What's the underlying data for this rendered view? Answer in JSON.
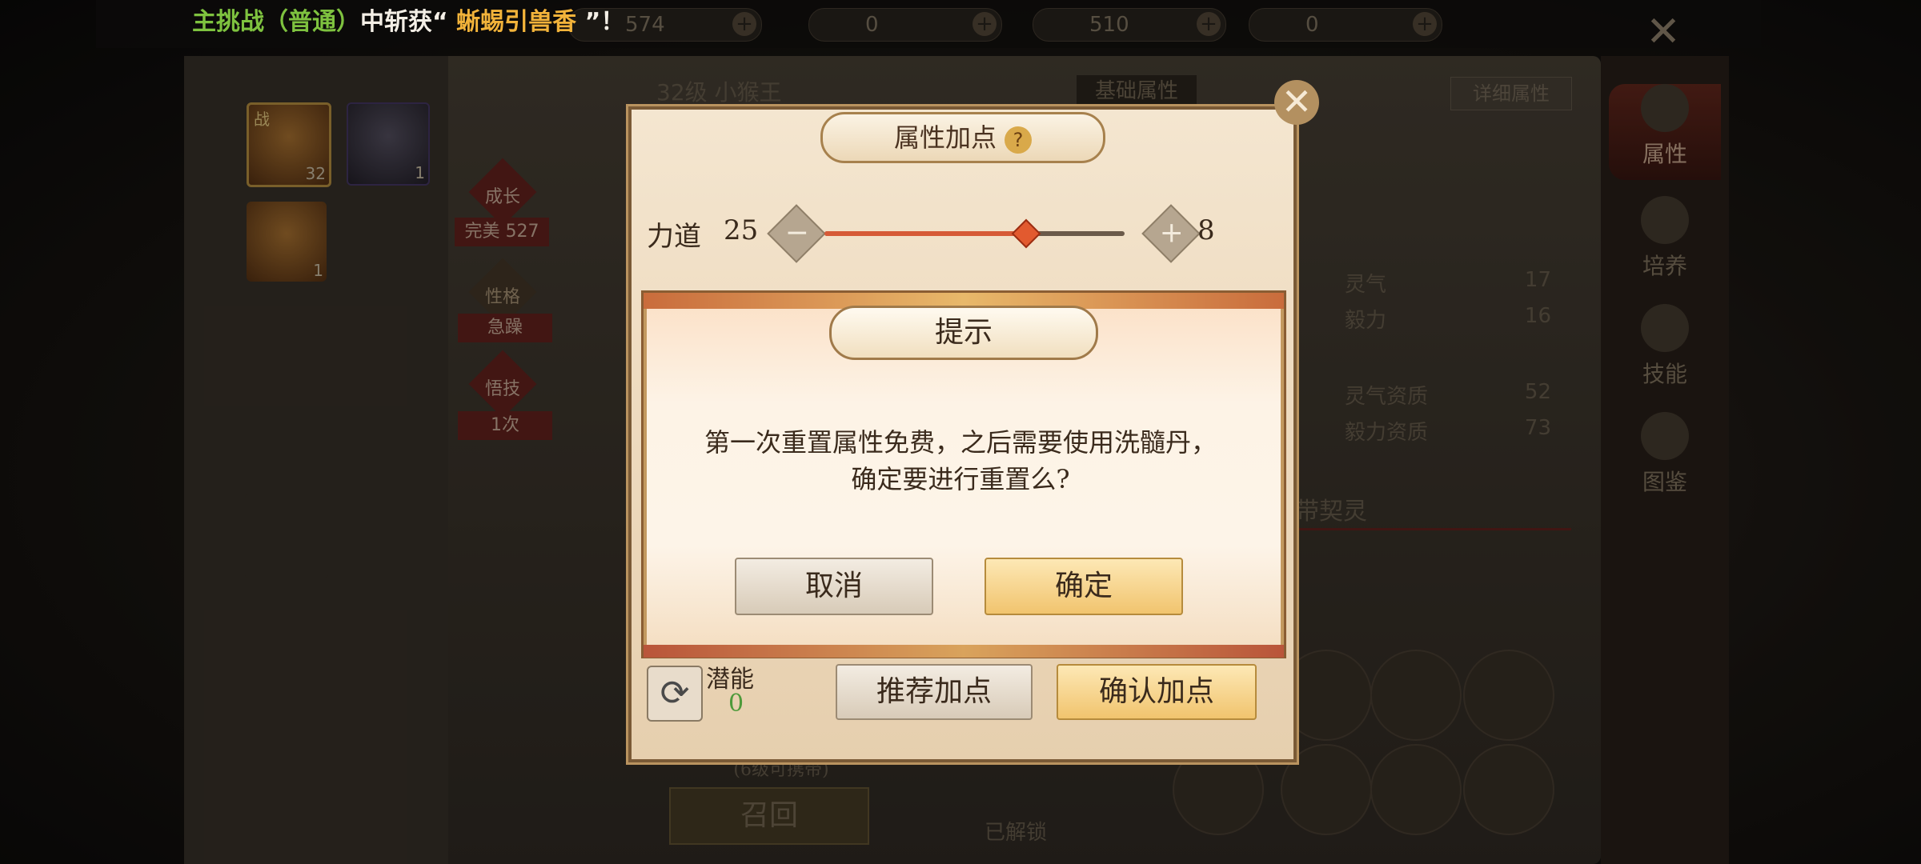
{
  "top_bar": {
    "banner_parts": [
      {
        "text": "主挑战",
        "color": "#7ec23f"
      },
      {
        "text": "（普通）",
        "color": "#7ec23f"
      },
      {
        "text": "中斩获“ ",
        "color": "#f4efe6"
      },
      {
        "text": "蜥蜴引兽香",
        "color": "#f2b33a"
      },
      {
        "text": " ”！",
        "color": "#f4efe6"
      }
    ],
    "resources": [
      {
        "value": "574"
      },
      {
        "value": "0"
      },
      {
        "value": "510"
      },
      {
        "value": "0"
      }
    ]
  },
  "pets": {
    "list": [
      {
        "tag": "战",
        "level": "32"
      },
      {
        "tag": "",
        "level": "1"
      },
      {
        "tag": "",
        "level": "1"
      }
    ],
    "growth_label": "成长",
    "growth_value": "完美 527",
    "personality_label": "性格",
    "personality_value": "急躁",
    "skill_label": "悟技",
    "skill_value": "1次"
  },
  "header": {
    "level_name": "32级 小猴王",
    "basic_attr_tab": "基础属性",
    "detail_attr_button": "详细属性"
  },
  "right_tabs": [
    {
      "label": "属性",
      "icon": "paw-icon",
      "active": true
    },
    {
      "label": "培养",
      "icon": "cultivate-icon",
      "active": false
    },
    {
      "label": "技能",
      "icon": "skill-book-icon",
      "active": false
    },
    {
      "label": "图鉴",
      "icon": "catalog-icon",
      "active": false
    }
  ],
  "right_info": {
    "rows": [
      {
        "name": "灵气",
        "value": "17"
      },
      {
        "name": "毅力",
        "value": "16"
      },
      {
        "name": "灵气资质",
        "value": "52"
      },
      {
        "name": "毅力资质",
        "value": "73"
      }
    ],
    "carry_label": "带契灵"
  },
  "bottom": {
    "recall_button": "召回",
    "carry_level_note": "(6级可携带)",
    "unlocked_label": "已解锁"
  },
  "attr_panel": {
    "title": "属性加点",
    "help": "?",
    "stat_label": "力道",
    "stat_value": "25",
    "stat_points": "8",
    "slider_fraction": 0.67,
    "minus": "−",
    "plus": "+",
    "potential_label": "潜能",
    "potential_value": "0",
    "recommend_button": "推荐加点",
    "confirm_button": "确认加点",
    "close": "✕"
  },
  "dialog": {
    "title": "提示",
    "message_line1": "第一次重置属性免费，之后需要使用洗髓丹，",
    "message_line2": "确定要进行重置么?",
    "cancel_button": "取消",
    "ok_button": "确定"
  },
  "colors": {
    "accent_gold": "#f1c46e",
    "potential_green": "#4e9a3a",
    "slider_red": "#d65a37"
  }
}
